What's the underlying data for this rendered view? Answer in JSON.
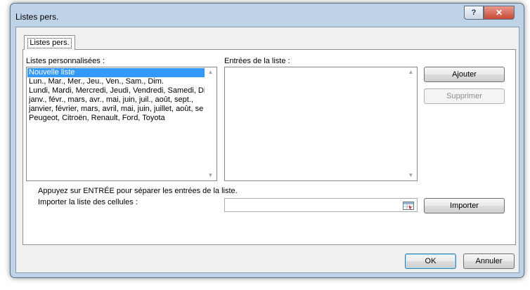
{
  "window": {
    "title": "Listes pers."
  },
  "titlebar": {
    "help_label": "?",
    "close_label": "✕"
  },
  "tab": {
    "label": "Listes pers."
  },
  "custom_lists": {
    "label": "Listes personnalisées :",
    "items": [
      "Nouvelle liste",
      "Lun., Mar., Mer., Jeu., Ven., Sam., Dim.",
      "Lundi, Mardi, Mercredi, Jeudi, Vendredi, Samedi, Dim",
      "janv., févr., mars, avr., mai, juin, juil., août, sept.,",
      "janvier, février, mars, avril, mai, juin, juillet, août, se",
      "Peugeot, Citroën, Renault, Ford, Toyota"
    ],
    "selected_index": 0
  },
  "entries": {
    "label": "Entrées de la liste :",
    "value": ""
  },
  "buttons": {
    "add": "Ajouter",
    "delete": "Supprimer",
    "import": "Importer",
    "ok": "OK",
    "cancel": "Annuler"
  },
  "hint": "Appuyez sur ENTRÉE pour séparer les entrées de la liste.",
  "import_field": {
    "label": "Importer la liste des cellules :",
    "value": ""
  },
  "colors": {
    "selection": "#3399ff",
    "window_frame": "#bfd3e8",
    "close": "#c84a36"
  },
  "icons": {
    "help": "help-icon",
    "close": "close-icon",
    "range_picker": "range-picker-icon",
    "scroll_up": "scroll-up-icon",
    "scroll_down": "scroll-down-icon"
  }
}
